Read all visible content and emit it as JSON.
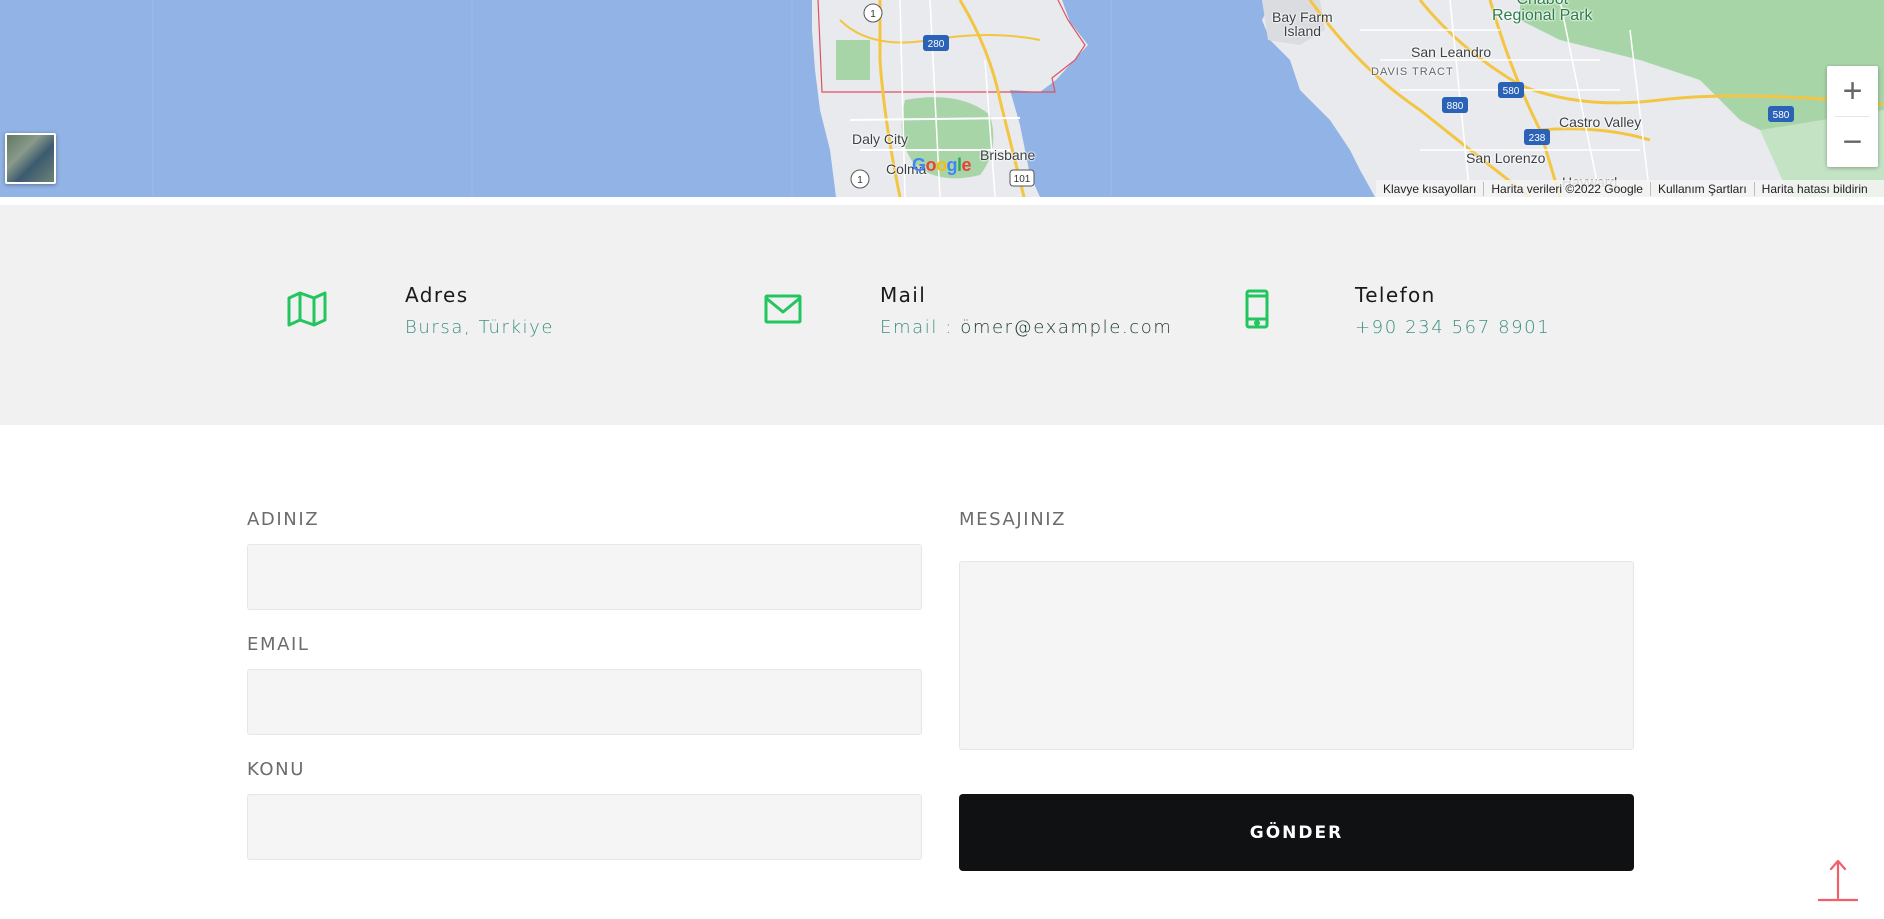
{
  "map": {
    "labels": {
      "bay_farm_island": "Bay Farm\nIsland",
      "regional_park": "Chabot\nRegional Park",
      "san_leandro": "San Leandro",
      "davis_tract": "DAVIS TRACT",
      "castro_valley": "Castro Valley",
      "san_lorenzo": "San Lorenzo",
      "daly_city": "Daly City",
      "colma": "Colma",
      "brisbane": "Brisbane",
      "hayward": "Hayward"
    },
    "shields": {
      "hwy1_top": "1",
      "i280": "280",
      "hwy1_bottom": "1",
      "us101": "101",
      "i880": "880",
      "i580_a": "580",
      "i238": "238",
      "i580_b": "580"
    },
    "logo": "Google",
    "zoom_in": "+",
    "zoom_out": "−",
    "attribution": {
      "keyboard": "Klavye kısayolları",
      "data": "Harita verileri ©2022 Google",
      "terms": "Kullanım Şartları",
      "report": "Harita hatası bildirin"
    }
  },
  "contact_info": {
    "address": {
      "title": "Adres",
      "value": "Bursa, Türkiye"
    },
    "mail": {
      "title": "Mail",
      "prefix": "Email : ",
      "value": "ömer@example.com"
    },
    "phone": {
      "title": "Telefon",
      "value": "+90 234 567 8901"
    }
  },
  "form": {
    "name_label": "ADINIZ",
    "name_value": "",
    "email_label": "EMAIL",
    "email_value": "",
    "subject_label": "KONU",
    "subject_value": "",
    "message_label": "MESAJINIZ",
    "message_value": "",
    "submit_label": "GÖNDER"
  },
  "colors": {
    "accent_green": "#22c55e",
    "info_text": "#3d8f83",
    "strip_bg": "#f0f1f0",
    "button_bg": "#0f1113",
    "scroll_top": "#f0606a"
  },
  "icons": {
    "address": "map-icon",
    "mail": "envelope-icon",
    "phone": "mobile-phone-icon",
    "scroll_top": "arrow-up-icon"
  }
}
